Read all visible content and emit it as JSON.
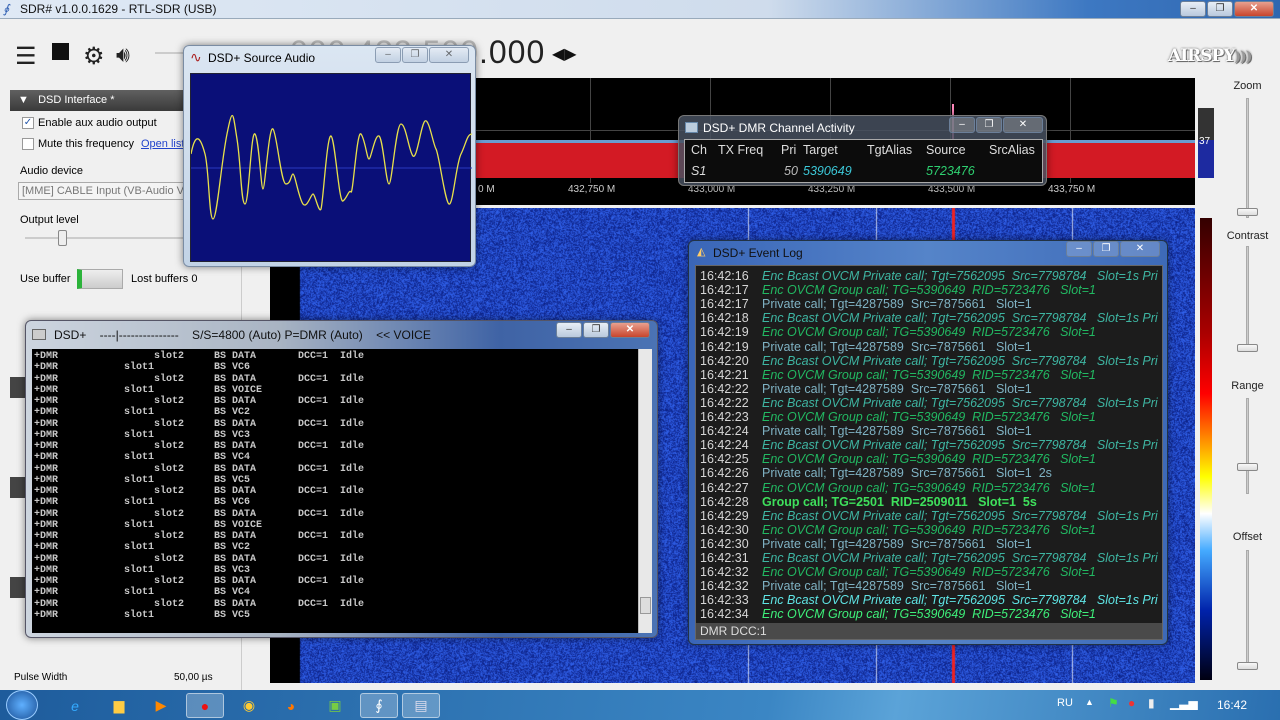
{
  "app": {
    "title": "SDR# v1.0.0.1629 - RTL-SDR (USB)"
  },
  "toolbar": {
    "menu_icon": "hamburger-icon",
    "stop_icon": "stop-icon",
    "settings_icon": "gear-icon",
    "volume_icon": "speaker-icon",
    "frequency_hidden": "000.433.500",
    "frequency_visible": ".000",
    "logo": "AIRSPY"
  },
  "left_panel": {
    "dsd_header": "DSD Interface *",
    "enable_aux": {
      "label": "Enable aux audio output",
      "checked": true
    },
    "mute": {
      "label": "Mute this frequency",
      "checked": false
    },
    "open_list": "Open list",
    "audio_device_label": "Audio device",
    "audio_device_value": "[MME] CABLE Input (VB-Audio Virtual",
    "output_level_label": "Output level",
    "output_level_fraction": 0.2,
    "use_buffer_label": "Use buffer",
    "lost_buffers": "Lost buffers 0",
    "pulse_width_label": "Pulse Width",
    "pulse_width_value": "50,00 µs"
  },
  "spectrum": {
    "freq_labels": [
      "0 M",
      "432,750 M",
      "433,000 M",
      "433,250 M",
      "433,500 M",
      "433,750 M"
    ],
    "level": "37",
    "level_fraction": 0.55
  },
  "right_controls": {
    "zoom": "Zoom",
    "contrast": "Contrast",
    "range": "Range",
    "offset": "Offset"
  },
  "audio_window": {
    "title": "DSD+ Source Audio"
  },
  "channel_window": {
    "title": "DSD+ DMR Channel Activity",
    "headers": [
      "Ch",
      "TX Freq",
      "Pri",
      "Target",
      "TgtAlias",
      "Source",
      "SrcAlias"
    ],
    "row": {
      "ch": "S1",
      "tx_freq": "",
      "pri": "50",
      "target": "5390649",
      "tgt_alias": "",
      "source": "5723476",
      "src_alias": ""
    }
  },
  "event_log": {
    "title": "DSD+ Event Log",
    "status": "DMR  DCC:1",
    "rows": [
      {
        "time": "16:42:16",
        "kind": "encb",
        "text": "Enc Bcast OVCM Private call; Tgt=7562095  Src=7798784   Slot=1s Pri"
      },
      {
        "time": "16:42:17",
        "kind": "encg",
        "text": "Enc OVCM Group call; TG=5390649  RID=5723476   Slot=1"
      },
      {
        "time": "16:42:17",
        "kind": "priv",
        "text": "Private call; Tgt=4287589  Src=7875661   Slot=1"
      },
      {
        "time": "16:42:18",
        "kind": "encb",
        "text": "Enc Bcast OVCM Private call; Tgt=7562095  Src=7798784   Slot=1s Pri"
      },
      {
        "time": "16:42:19",
        "kind": "encg",
        "text": "Enc OVCM Group call; TG=5390649  RID=5723476   Slot=1"
      },
      {
        "time": "16:42:19",
        "kind": "priv",
        "text": "Private call; Tgt=4287589  Src=7875661   Slot=1"
      },
      {
        "time": "16:42:20",
        "kind": "encb",
        "text": "Enc Bcast OVCM Private call; Tgt=7562095  Src=7798784   Slot=1s Pri"
      },
      {
        "time": "16:42:21",
        "kind": "encg",
        "text": "Enc OVCM Group call; TG=5390649  RID=5723476   Slot=1"
      },
      {
        "time": "16:42:22",
        "kind": "priv",
        "text": "Private call; Tgt=4287589  Src=7875661   Slot=1"
      },
      {
        "time": "16:42:22",
        "kind": "encb",
        "text": "Enc Bcast OVCM Private call; Tgt=7562095  Src=7798784   Slot=1s Pri"
      },
      {
        "time": "16:42:23",
        "kind": "encg",
        "text": "Enc OVCM Group call; TG=5390649  RID=5723476   Slot=1"
      },
      {
        "time": "16:42:24",
        "kind": "priv",
        "text": "Private call; Tgt=4287589  Src=7875661   Slot=1"
      },
      {
        "time": "16:42:24",
        "kind": "encb",
        "text": "Enc Bcast OVCM Private call; Tgt=7562095  Src=7798784   Slot=1s Pri"
      },
      {
        "time": "16:42:25",
        "kind": "encg",
        "text": "Enc OVCM Group call; TG=5390649  RID=5723476   Slot=1"
      },
      {
        "time": "16:42:26",
        "kind": "priv",
        "text": "Private call; Tgt=4287589  Src=7875661   Slot=1  2s"
      },
      {
        "time": "16:42:27",
        "kind": "encg",
        "text": "Enc OVCM Group call; TG=5390649  RID=5723476   Slot=1"
      },
      {
        "time": "16:42:28",
        "kind": "grp",
        "text": "Group call; TG=2501  RID=2509011   Slot=1  5s"
      },
      {
        "time": "16:42:29",
        "kind": "encb",
        "text": "Enc Bcast OVCM Private call; Tgt=7562095  Src=7798784   Slot=1s Pri"
      },
      {
        "time": "16:42:30",
        "kind": "encg",
        "text": "Enc OVCM Group call; TG=5390649  RID=5723476   Slot=1"
      },
      {
        "time": "16:42:30",
        "kind": "priv",
        "text": "Private call; Tgt=4287589  Src=7875661   Slot=1"
      },
      {
        "time": "16:42:31",
        "kind": "encb",
        "text": "Enc Bcast OVCM Private call; Tgt=7562095  Src=7798784   Slot=1s Pri"
      },
      {
        "time": "16:42:32",
        "kind": "encg",
        "text": "Enc OVCM Group call; TG=5390649  RID=5723476   Slot=1"
      },
      {
        "time": "16:42:32",
        "kind": "priv",
        "text": "Private call; Tgt=4287589  Src=7875661   Slot=1"
      },
      {
        "time": "16:42:33",
        "kind": "encb-hi",
        "text": "Enc Bcast OVCM Private call; Tgt=7562095  Src=7798784   Slot=1s Pri"
      },
      {
        "time": "16:42:34",
        "kind": "encg-hi",
        "text": "Enc OVCM Group call; TG=5390649  RID=5723476   Slot=1"
      }
    ]
  },
  "console": {
    "title": "DSD+    ----|---------------    S/S=4800 (Auto) P=DMR (Auto)    << VOICE",
    "lines": [
      "+DMR                slot2     BS DATA       DCC=1  Idle",
      "+DMR           slot1          BS VC6",
      "+DMR                slot2     BS DATA       DCC=1  Idle",
      "+DMR           slot1          BS VOICE",
      "+DMR                slot2     BS DATA       DCC=1  Idle",
      "+DMR           slot1          BS VC2",
      "+DMR                slot2     BS DATA       DCC=1  Idle",
      "+DMR           slot1          BS VC3",
      "+DMR                slot2     BS DATA       DCC=1  Idle",
      "+DMR           slot1          BS VC4",
      "+DMR                slot2     BS DATA       DCC=1  Idle",
      "+DMR           slot1          BS VC5",
      "+DMR                slot2     BS DATA       DCC=1  Idle",
      "+DMR           slot1          BS VC6",
      "+DMR                slot2     BS DATA       DCC=1  Idle",
      "+DMR           slot1          BS VOICE",
      "+DMR                slot2     BS DATA       DCC=1  Idle",
      "+DMR           slot1          BS VC2",
      "+DMR                slot2     BS DATA       DCC=1  Idle",
      "+DMR           slot1          BS VC3",
      "+DMR                slot2     BS DATA       DCC=1  Idle",
      "+DMR           slot1          BS VC4",
      "+DMR                slot2     BS DATA       DCC=1  Idle",
      "+DMR           slot1          BS VC5"
    ]
  },
  "taskbar": {
    "language": "RU",
    "clock": "16:42",
    "apps": [
      "ie",
      "explorer",
      "media-player",
      "opera",
      "chrome",
      "firefox",
      "notepad",
      "sdrsharp",
      "dsdplus"
    ]
  },
  "colors": {
    "waterfall": "#0b1d88",
    "spectrum_fill": "#d31a24",
    "scope_bg": "#0a0f78",
    "scope_trace": "#e8e04a"
  }
}
